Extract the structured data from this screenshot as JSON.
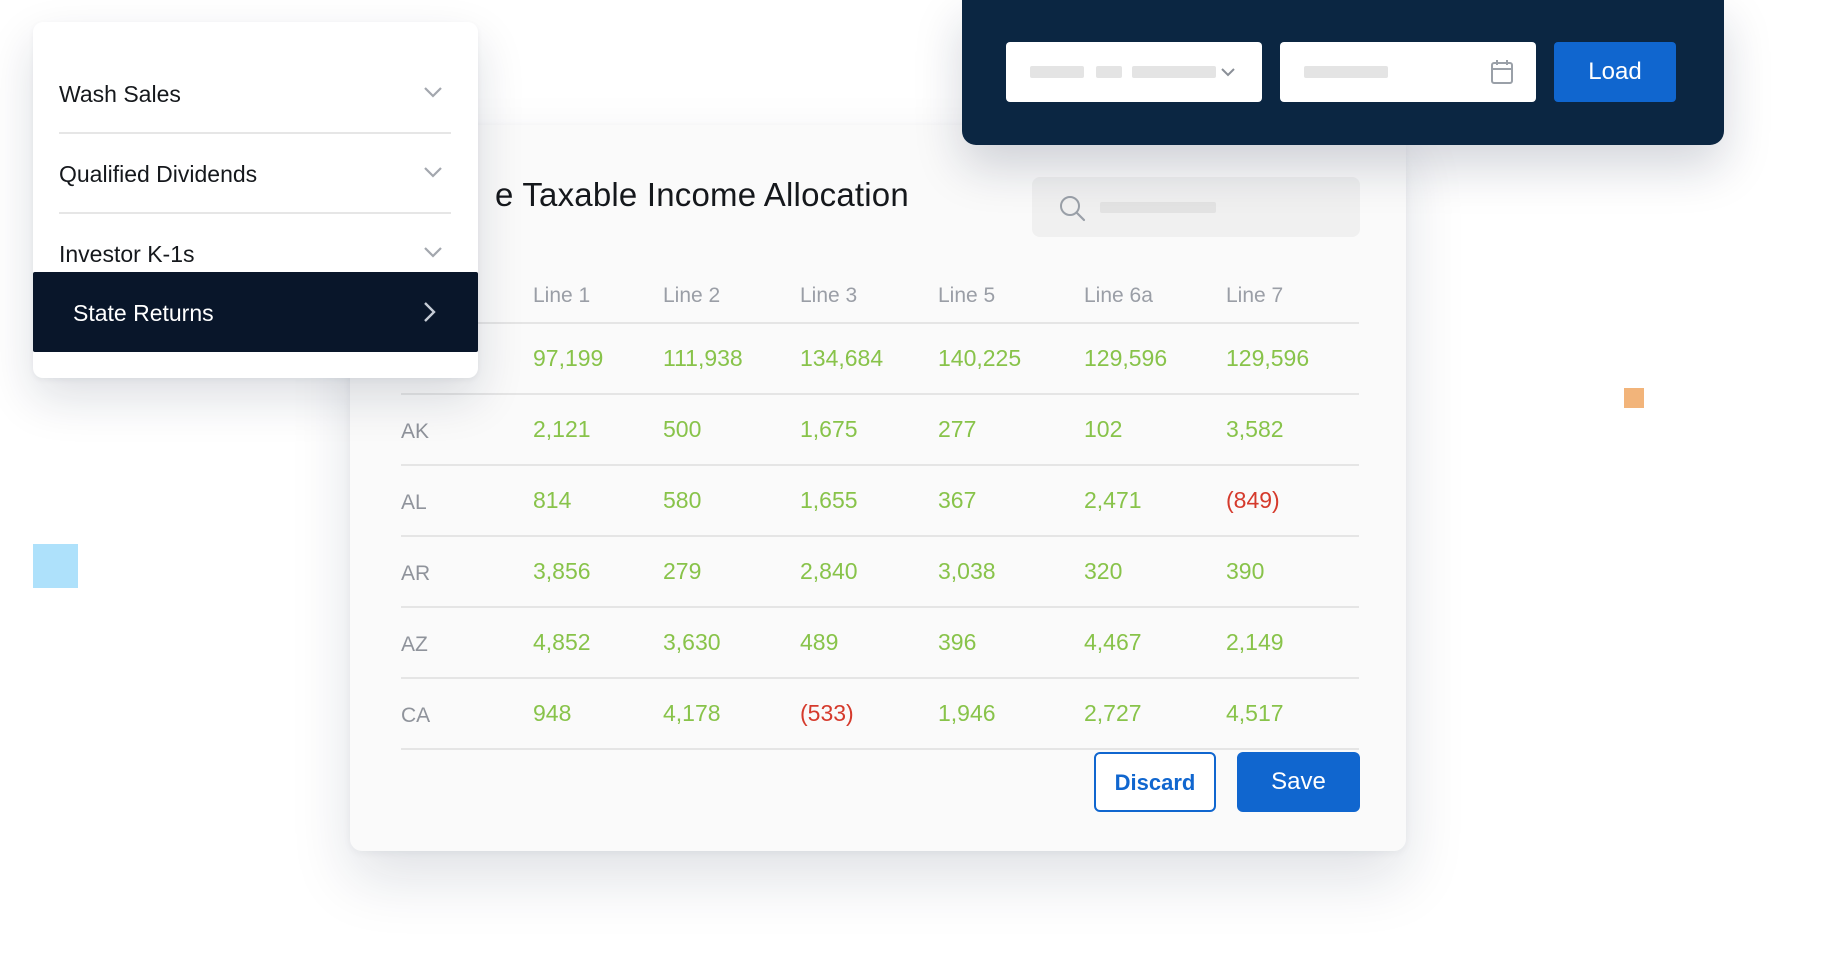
{
  "table_panel": {
    "title": "e Taxable Income Allocation",
    "columns": [
      "",
      "Line 1",
      "Line 2",
      "Line 3",
      "Line 5",
      "Line 6a",
      "Line 7"
    ],
    "rows": [
      {
        "state": "",
        "values": [
          "97,199",
          "111,938",
          "134,684",
          "140,225",
          "129,596",
          "129,596"
        ]
      },
      {
        "state": "AK",
        "values": [
          "2,121",
          "500",
          "1,675",
          "277",
          "102",
          "3,582"
        ]
      },
      {
        "state": "AL",
        "values": [
          "814",
          "580",
          "1,655",
          "367",
          "2,471",
          "(849)"
        ]
      },
      {
        "state": "AR",
        "values": [
          "3,856",
          "279",
          "2,840",
          "3,038",
          "320",
          "390"
        ]
      },
      {
        "state": "AZ",
        "values": [
          "4,852",
          "3,630",
          "489",
          "396",
          "4,467",
          "2,149"
        ]
      },
      {
        "state": "CA",
        "values": [
          "948",
          "4,178",
          "(533)",
          "1,946",
          "2,727",
          "4,517"
        ]
      }
    ],
    "discard_label": "Discard",
    "save_label": "Save"
  },
  "sidebar": {
    "items": [
      {
        "label": "Wash Sales",
        "icon": "chevron-down-icon"
      },
      {
        "label": "Qualified Dividends",
        "icon": "chevron-down-icon"
      },
      {
        "label": "Investor K-1s",
        "icon": "chevron-down-icon"
      }
    ],
    "active_item": {
      "label": "State Returns",
      "icon": "chevron-right-icon"
    }
  },
  "toolbar": {
    "load_label": "Load"
  },
  "colors": {
    "accent": "#1066cf",
    "navy": "#0b2642",
    "active_menu": "#09162a",
    "positive": "#88c34a",
    "negative": "#d53a2c"
  }
}
